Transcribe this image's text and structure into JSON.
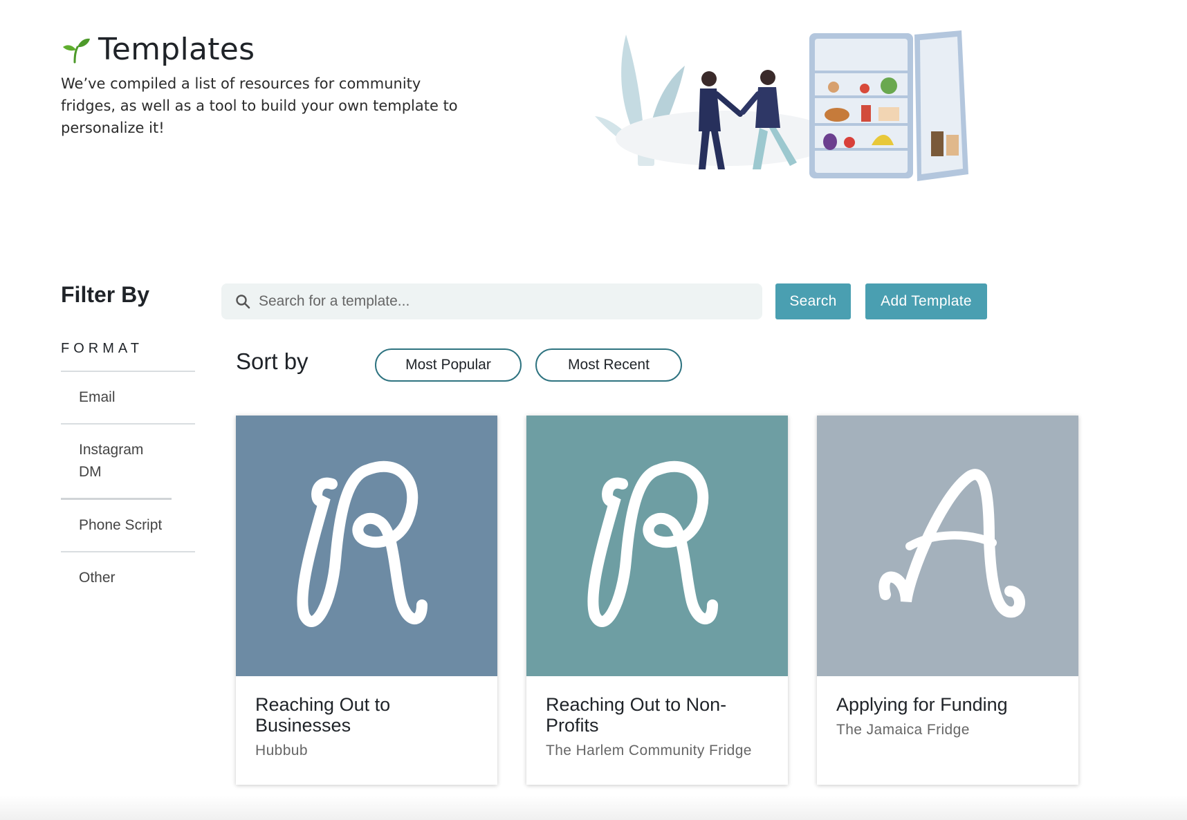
{
  "header": {
    "title": "Templates",
    "intro": "We’ve compiled a list of resources for community fridges, as well as a tool to build your own template to personalize it!"
  },
  "filter": {
    "heading": "Filter By",
    "group_label": "FORMAT",
    "options": [
      "Email",
      "Instagram DM",
      "Phone Script",
      "Other"
    ]
  },
  "search": {
    "placeholder": "Search for a template...",
    "search_button": "Search",
    "add_button": "Add Template"
  },
  "sort": {
    "label": "Sort by",
    "options": [
      "Most Popular",
      "Most Recent"
    ]
  },
  "cards": [
    {
      "letter": "R",
      "title": "Reaching Out to Businesses",
      "org": "Hubbub",
      "color": "#6d8ba4"
    },
    {
      "letter": "R",
      "title": "Reaching Out to Non-Profits",
      "org": "The Harlem Community Fridge",
      "color": "#6e9ea3"
    },
    {
      "letter": "A",
      "title": "Applying for Funding",
      "org": "The Jamaica Fridge",
      "color": "#a4b1bc"
    }
  ],
  "colors": {
    "accent": "#4a9fb1",
    "pill_border": "#2e7380",
    "search_bg": "#eef3f3"
  }
}
